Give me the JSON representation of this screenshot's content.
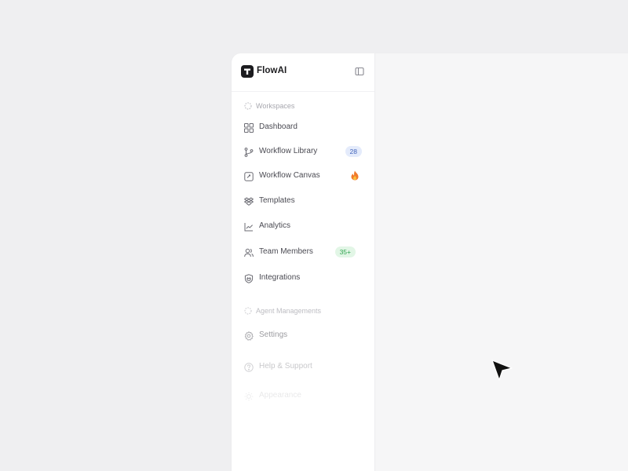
{
  "brand": {
    "name": "FlowAI",
    "logo_icon": "flowai-logo",
    "collapse_icon": "sidebar-toggle-icon"
  },
  "sections": {
    "workspaces": {
      "label": "Workspaces"
    },
    "agent": {
      "label": "Agent Managements"
    }
  },
  "nav": {
    "dashboard": {
      "label": "Dashboard",
      "icon": "grid-icon"
    },
    "workflow_library": {
      "label": "Workflow Library",
      "icon": "git-branch-icon",
      "badge": "28"
    },
    "workflow_canvas": {
      "label": "Workflow  Canvas",
      "icon": "canvas-icon",
      "badge_icon": "fire-icon"
    },
    "templates": {
      "label": "Templates",
      "icon": "dropbox-icon"
    },
    "analytics": {
      "label": "Analytics",
      "icon": "chart-icon"
    },
    "team_members": {
      "label": "Team Members",
      "icon": "users-icon",
      "badge": "35+"
    },
    "integrations": {
      "label": "Integrations",
      "icon": "shield-plug-icon"
    },
    "settings": {
      "label": "Settings",
      "icon": "gear-icon"
    },
    "help_support": {
      "label": "Help & Support",
      "icon": "help-circle-icon"
    },
    "appearance": {
      "label": "Appearance",
      "icon": "sun-icon"
    }
  },
  "colors": {
    "background": "#efeff1",
    "sidebar": "#ffffff",
    "badge_blue_bg": "#e4ebfb",
    "badge_blue_text": "#4466bb",
    "badge_green_bg": "#e2f6e6",
    "badge_green_text": "#33a552",
    "fire": "#f07a2c"
  }
}
